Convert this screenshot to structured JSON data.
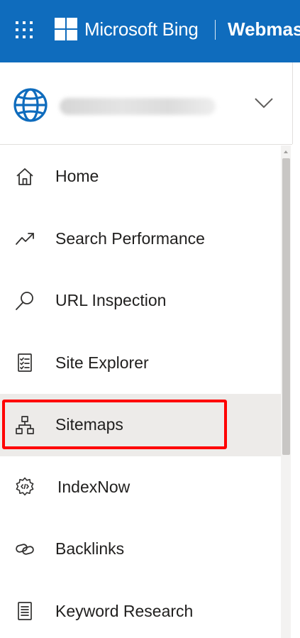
{
  "topbar": {
    "brand": "Microsoft Bing",
    "product": "Webmaster Tools",
    "background": "#0f6cbd"
  },
  "site_selector": {
    "icon": "globe-icon",
    "expand_icon": "chevron-down-icon"
  },
  "nav": {
    "items": [
      {
        "label": "Home",
        "icon": "home-icon"
      },
      {
        "label": "Search Performance",
        "icon": "trend-up-icon"
      },
      {
        "label": "URL Inspection",
        "icon": "magnifier-icon"
      },
      {
        "label": "Site Explorer",
        "icon": "checklist-icon"
      },
      {
        "label": "Sitemaps",
        "icon": "sitemap-icon",
        "selected": true
      },
      {
        "label": "IndexNow",
        "icon": "gear-code-icon"
      },
      {
        "label": "Backlinks",
        "icon": "link-icon"
      },
      {
        "label": "Keyword Research",
        "icon": "document-list-icon"
      }
    ],
    "selected_background": "#edebe9",
    "highlight_color": "#ff0000"
  }
}
